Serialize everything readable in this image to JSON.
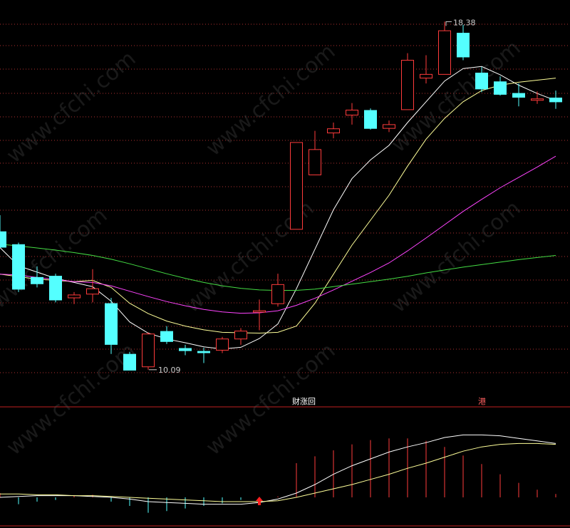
{
  "chart_data": [
    {
      "type": "candlestick",
      "panel": "price",
      "high_label": "18.38",
      "low_label": "10.09",
      "colors": {
        "up": "#ff3b3b",
        "down": "#54ffff",
        "ma_white": "#ffffff",
        "ma_yellow": "#ffff99",
        "ma_magenta": "#ff44ff",
        "ma_green": "#44dd44",
        "grid": "#b03030"
      },
      "candles": [
        {
          "o": 13.33,
          "h": 13.72,
          "l": 12.99,
          "c": 12.94
        },
        {
          "o": 13.02,
          "h": 13.06,
          "l": 11.87,
          "c": 11.93
        },
        {
          "o": 12.23,
          "h": 12.49,
          "l": 11.98,
          "c": 12.06
        },
        {
          "o": 12.26,
          "h": 12.31,
          "l": 11.62,
          "c": 11.67
        },
        {
          "o": 11.73,
          "h": 11.87,
          "l": 11.58,
          "c": 11.8
        },
        {
          "o": 11.82,
          "h": 12.42,
          "l": 11.62,
          "c": 11.95
        },
        {
          "o": 11.6,
          "h": 11.73,
          "l": 10.38,
          "c": 10.6
        },
        {
          "o": 10.38,
          "h": 10.43,
          "l": 10.09,
          "c": 9.98
        },
        {
          "o": 10.07,
          "h": 10.9,
          "l": 10.0,
          "c": 10.86
        },
        {
          "o": 10.93,
          "h": 11.05,
          "l": 10.62,
          "c": 10.67
        },
        {
          "o": 10.52,
          "h": 10.6,
          "l": 10.35,
          "c": 10.45
        },
        {
          "o": 10.45,
          "h": 10.53,
          "l": 10.16,
          "c": 10.4
        },
        {
          "o": 10.47,
          "h": 10.79,
          "l": 10.4,
          "c": 10.74
        },
        {
          "o": 10.74,
          "h": 11.0,
          "l": 10.6,
          "c": 10.93
        },
        {
          "o": 11.42,
          "h": 11.69,
          "l": 10.95,
          "c": 11.42
        },
        {
          "o": 11.59,
          "h": 12.31,
          "l": 11.52,
          "c": 12.05
        },
        {
          "o": 13.38,
          "h": 15.47,
          "l": 13.38,
          "c": 15.47
        },
        {
          "o": 14.69,
          "h": 15.75,
          "l": 14.69,
          "c": 15.3
        },
        {
          "o": 15.7,
          "h": 15.95,
          "l": 15.57,
          "c": 15.8
        },
        {
          "o": 16.13,
          "h": 16.42,
          "l": 15.9,
          "c": 16.25
        },
        {
          "o": 16.25,
          "h": 16.29,
          "l": 15.78,
          "c": 15.8
        },
        {
          "o": 15.81,
          "h": 16.0,
          "l": 15.72,
          "c": 15.9
        },
        {
          "o": 16.26,
          "h": 17.62,
          "l": 16.26,
          "c": 17.45
        },
        {
          "o": 17.02,
          "h": 17.57,
          "l": 16.89,
          "c": 17.11
        },
        {
          "o": 17.11,
          "h": 18.38,
          "l": 17.11,
          "c": 18.16
        },
        {
          "o": 18.11,
          "h": 18.3,
          "l": 17.45,
          "c": 17.52
        },
        {
          "o": 17.15,
          "h": 17.29,
          "l": 16.68,
          "c": 16.75
        },
        {
          "o": 16.94,
          "h": 17.06,
          "l": 16.6,
          "c": 16.62
        },
        {
          "o": 16.66,
          "h": 16.89,
          "l": 16.34,
          "c": 16.55
        },
        {
          "o": 16.52,
          "h": 16.7,
          "l": 16.4,
          "c": 16.52
        },
        {
          "o": 16.55,
          "h": 16.72,
          "l": 16.28,
          "c": 16.44
        }
      ],
      "ma_series": [
        {
          "color": "white",
          "values": [
            12.94,
            12.5,
            12.35,
            12.2,
            12.1,
            12.0,
            11.65,
            11.15,
            10.88,
            10.74,
            10.65,
            10.55,
            10.5,
            10.54,
            10.75,
            11.1,
            11.95,
            12.9,
            13.85,
            14.6,
            15.05,
            15.4,
            15.95,
            16.45,
            16.95,
            17.25,
            17.3,
            17.1,
            16.85,
            16.65,
            16.48
          ]
        },
        {
          "color": "yellow",
          "values": [
            12.3,
            12.24,
            12.18,
            12.15,
            12.12,
            12.15,
            11.98,
            11.6,
            11.35,
            11.17,
            11.05,
            10.96,
            10.9,
            10.89,
            10.88,
            10.9,
            11.05,
            11.6,
            12.3,
            13.0,
            13.6,
            14.2,
            14.9,
            15.55,
            16.05,
            16.45,
            16.72,
            16.85,
            16.92,
            16.97,
            17.02
          ]
        },
        {
          "color": "magenta",
          "values": [
            12.3,
            12.28,
            12.22,
            12.17,
            12.12,
            12.1,
            12.02,
            11.89,
            11.76,
            11.64,
            11.54,
            11.45,
            11.39,
            11.36,
            11.37,
            11.42,
            11.55,
            11.72,
            11.92,
            12.13,
            12.34,
            12.57,
            12.86,
            13.17,
            13.49,
            13.81,
            14.1,
            14.38,
            14.63,
            14.88,
            15.14
          ]
        },
        {
          "color": "green",
          "values": [
            13.02,
            12.98,
            12.93,
            12.88,
            12.82,
            12.75,
            12.66,
            12.55,
            12.43,
            12.31,
            12.2,
            12.1,
            12.02,
            11.96,
            11.92,
            11.91,
            11.91,
            11.94,
            12.0,
            12.06,
            12.12,
            12.18,
            12.25,
            12.33,
            12.4,
            12.47,
            12.53,
            12.59,
            12.65,
            12.7,
            12.75
          ]
        }
      ]
    },
    {
      "type": "bar",
      "panel": "indicator",
      "label_left": "财涨回",
      "label_right": "港",
      "arrow_index": 14,
      "ylim": [
        0,
        1
      ],
      "bars": [
        0.05,
        -0.08,
        -0.05,
        -0.03,
        0.02,
        0.03,
        -0.05,
        -0.1,
        -0.18,
        -0.16,
        -0.13,
        -0.1,
        -0.07,
        -0.03,
        0,
        0.01,
        0.4,
        0.48,
        0.55,
        0.62,
        0.67,
        0.69,
        0.69,
        0.66,
        0.59,
        0.49,
        0.39,
        0.27,
        0.17,
        0.09,
        0.04
      ],
      "lines": [
        {
          "color": "white",
          "values": [
            0.0,
            0.01,
            0.02,
            0.02,
            0.02,
            0.01,
            0.0,
            -0.02,
            -0.05,
            -0.06,
            -0.07,
            -0.08,
            -0.08,
            -0.08,
            -0.06,
            -0.02,
            0.05,
            0.15,
            0.27,
            0.37,
            0.45,
            0.53,
            0.59,
            0.64,
            0.7,
            0.73,
            0.73,
            0.72,
            0.69,
            0.66,
            0.63
          ]
        },
        {
          "color": "yellow",
          "values": [
            0.04,
            0.04,
            0.03,
            0.03,
            0.02,
            0.02,
            0.01,
            0.0,
            -0.01,
            -0.02,
            -0.03,
            -0.04,
            -0.05,
            -0.05,
            -0.05,
            -0.04,
            0.0,
            0.05,
            0.1,
            0.15,
            0.21,
            0.27,
            0.34,
            0.4,
            0.47,
            0.54,
            0.59,
            0.62,
            0.63,
            0.63,
            0.62
          ]
        }
      ]
    }
  ],
  "watermark": "www.cfchi.com"
}
